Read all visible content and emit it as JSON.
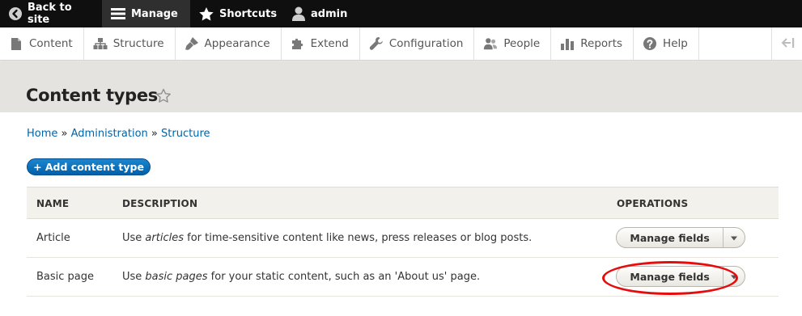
{
  "toolbar": {
    "back_label": "Back to site",
    "manage_label": "Manage",
    "shortcuts_label": "Shortcuts",
    "user_label": "admin"
  },
  "tray": {
    "items": [
      {
        "label": "Content",
        "icon": "file-icon"
      },
      {
        "label": "Structure",
        "icon": "sitemap-icon"
      },
      {
        "label": "Appearance",
        "icon": "paintbrush-icon"
      },
      {
        "label": "Extend",
        "icon": "puzzle-icon"
      },
      {
        "label": "Configuration",
        "icon": "wrench-icon"
      },
      {
        "label": "People",
        "icon": "people-icon"
      },
      {
        "label": "Reports",
        "icon": "bar-chart-icon"
      },
      {
        "label": "Help",
        "icon": "question-icon"
      }
    ]
  },
  "page": {
    "title": "Content types"
  },
  "breadcrumb": {
    "home": "Home",
    "sep": "»",
    "administration": "Administration",
    "structure": "Structure"
  },
  "actions": {
    "add_label": "+ Add content type"
  },
  "table": {
    "headers": {
      "name": "NAME",
      "description": "DESCRIPTION",
      "operations": "OPERATIONS"
    },
    "rows": [
      {
        "name": "Article",
        "desc_pre": "Use ",
        "desc_em": "articles",
        "desc_post": " for time-sensitive content like news, press releases or blog posts.",
        "operation": "Manage fields"
      },
      {
        "name": "Basic page",
        "desc_pre": "Use ",
        "desc_em": "basic pages",
        "desc_post": " for your static content, such as an 'About us' page.",
        "operation": "Manage fields"
      }
    ]
  },
  "colors": {
    "toolbar_bg": "#0f0f0f",
    "link": "#0064a8",
    "primary_button": "#0071c5",
    "annotation": "#e50c0c"
  }
}
